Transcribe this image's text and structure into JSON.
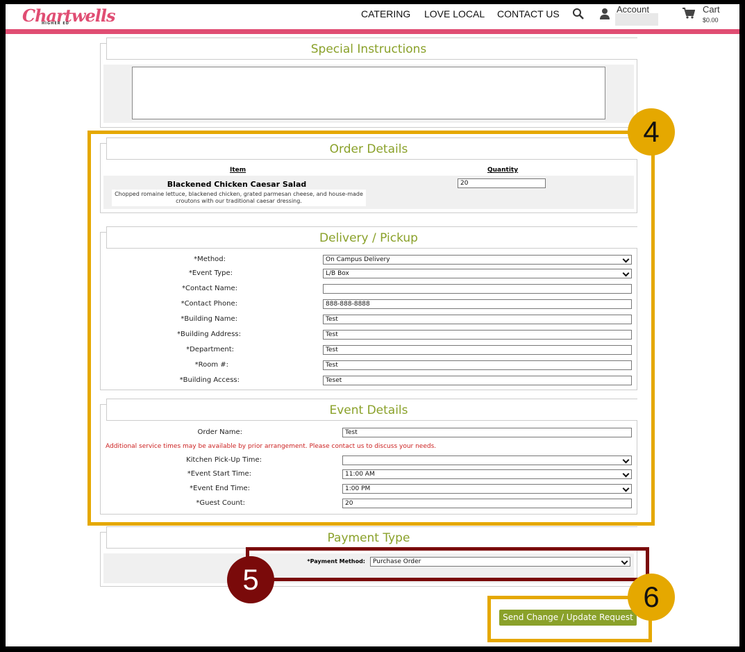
{
  "header": {
    "logo_text": "Chartwells",
    "logo_sub": "HIGHER ED",
    "nav": [
      "CATERING",
      "LOVE LOCAL",
      "CONTACT US"
    ],
    "account_label": "Account",
    "cart_label": "Cart",
    "cart_total": "$0.00"
  },
  "special": {
    "title": "Special Instructions",
    "value": ""
  },
  "order": {
    "title": "Order Details",
    "col_item": "Item",
    "col_qty": "Quantity",
    "item_name": "Blackened Chicken Caesar Salad",
    "item_desc": "Chopped romaine lettuce, blackened chicken, grated parmesan cheese, and house-made croutons with our traditional caesar dressing.",
    "quantity": "20"
  },
  "delivery": {
    "title": "Delivery / Pickup",
    "fields": [
      {
        "label": "*Method:",
        "value": "On Campus Delivery"
      },
      {
        "label": "*Event Type:",
        "value": "L/B Box"
      },
      {
        "label": "*Contact Name:",
        "value": ""
      },
      {
        "label": "*Contact Phone:",
        "value": "888-888-8888"
      },
      {
        "label": "*Building Name:",
        "value": "Test"
      },
      {
        "label": "*Building Address:",
        "value": "Test"
      },
      {
        "label": "*Department:",
        "value": "Test"
      },
      {
        "label": "*Room #:",
        "value": "Test"
      },
      {
        "label": "*Building Access:",
        "value": "Teset"
      }
    ]
  },
  "event": {
    "title": "Event Details",
    "order_name_label": "Order Name:",
    "order_name": "Test",
    "notice": "Additional service times may be available by prior arrangement. Please contact us to discuss your needs.",
    "fields": [
      {
        "label": "Kitchen Pick-Up Time:",
        "value": ""
      },
      {
        "label": "*Event Start Time:",
        "value": "11:00 AM"
      },
      {
        "label": "*Event End Time:",
        "value": "1:00 PM"
      },
      {
        "label": "*Guest Count:",
        "value": "20"
      }
    ]
  },
  "payment": {
    "title": "Payment Type",
    "method_label": "*Payment Method:",
    "method_value": "Purchase Order"
  },
  "submit_label": "Send Change / Update Request",
  "callouts": {
    "c4": "4",
    "c5": "5",
    "c6": "6"
  },
  "colors": {
    "accent_green": "#8aa12a",
    "brand_pink": "#e04d73",
    "callout_gold": "#e5a800",
    "callout_maroon": "#7a0a0a",
    "notice_red": "#cc2222"
  }
}
